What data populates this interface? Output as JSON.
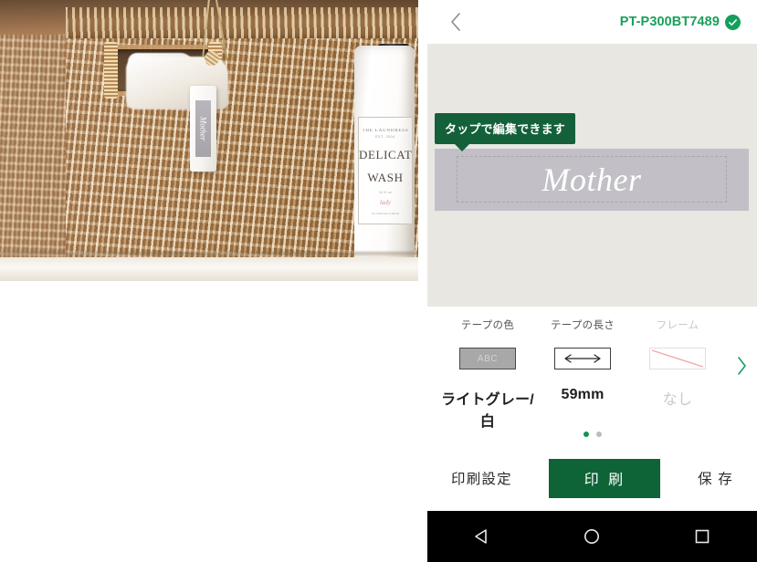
{
  "photo": {
    "alt_description": "woven rattan storage basket with hanging Mother label tag on a shelf",
    "tag_label_text": "Mother",
    "bottle": {
      "brand": "THE LAUNDRESS",
      "brand_sub": "EST. 2004",
      "product_line1": "DELICATE",
      "product_line2": "WASH",
      "size_note": "16 fl oz",
      "script": "lady",
      "fine_print": "for Cashmere & Wools"
    }
  },
  "header": {
    "back_icon": "chevron-left-icon",
    "device_name": "PT-P300BT7489",
    "connected_icon": "check-circle-icon",
    "accent_color": "#1a9f5c"
  },
  "canvas": {
    "tooltip_text": "タップで編集できます",
    "tooltip_color": "#14603a",
    "label": {
      "text": "Mother",
      "tape_bg_color": "#c2c0c6",
      "text_color": "#ffffff"
    },
    "background_color": "#e8e7e2"
  },
  "options": {
    "items": [
      {
        "title": "テープの色",
        "value": "ライトグレー/白",
        "thumb_icon": "tape-color-swatch-icon",
        "thumb_text": "ABC",
        "disabled": false
      },
      {
        "title": "テープの長さ",
        "value": "59mm",
        "thumb_icon": "tape-length-arrow-icon",
        "thumb_text": "",
        "disabled": false
      },
      {
        "title": "フレーム",
        "value": "なし",
        "thumb_icon": "frame-none-icon",
        "thumb_text": "",
        "disabled": true
      }
    ],
    "next_icon": "chevron-right-icon"
  },
  "pagination": {
    "dots": [
      {
        "active": true
      },
      {
        "active": false
      }
    ],
    "active_color": "#129152",
    "inactive_color": "#bdbdbd"
  },
  "actions": {
    "print_settings_label": "印刷設定",
    "print_label": "印 刷",
    "save_label": "保 存",
    "print_button_color": "#0e6337"
  },
  "navbar": {
    "back_icon": "android-back-triangle-icon",
    "home_icon": "android-home-circle-icon",
    "recents_icon": "android-recents-square-icon"
  }
}
